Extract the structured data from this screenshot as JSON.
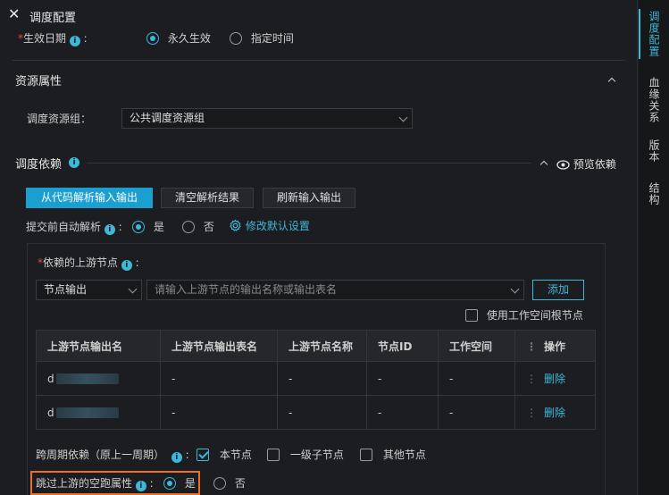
{
  "header": {
    "title": "调度配置"
  },
  "effective_date": {
    "label": "生效日期",
    "options": [
      "永久生效",
      "指定时间"
    ],
    "selected": "永久生效"
  },
  "resource_section": {
    "title": "资源属性",
    "group_label": "调度资源组：",
    "group_value": "公共调度资源组"
  },
  "dependency_section": {
    "title": "调度依赖",
    "preview_label": "预览依赖",
    "buttons": {
      "parse": "从代码解析输入输出",
      "clear": "清空解析结果",
      "refresh": "刷新输入输出"
    },
    "auto_parse": {
      "label": "提交前自动解析",
      "options": [
        "是",
        "否"
      ],
      "selected": "是",
      "modify_default": "修改默认设置"
    }
  },
  "upstream": {
    "label": "依赖的上游节点",
    "type_select": "节点输出",
    "input_placeholder": "请输入上游节点的输出名称或输出表名",
    "add_button": "添加",
    "use_root": "使用工作空间根节点",
    "columns": [
      "上游节点输出名",
      "上游节点输出表名",
      "上游节点名称",
      "节点ID",
      "工作空间",
      "操作"
    ],
    "rows": [
      {
        "output_prefix": "d",
        "output_table": "-",
        "node_name": "-",
        "node_id": "-",
        "workspace": "-",
        "action": "删除"
      },
      {
        "output_prefix": "d",
        "output_table": "-",
        "node_name": "-",
        "node_id": "-",
        "workspace": "-",
        "action": "删除"
      }
    ]
  },
  "cross_cycle": {
    "label": "跨周期依赖（原上一周期）",
    "options": [
      {
        "label": "本节点",
        "checked": true
      },
      {
        "label": "一级子节点",
        "checked": false
      },
      {
        "label": "其他节点",
        "checked": false
      }
    ]
  },
  "skip_dry_run": {
    "label": "跳过上游的空跑属性",
    "options": [
      "是",
      "否"
    ],
    "selected": "是"
  },
  "sidebar": {
    "items": [
      {
        "label": "调度配置",
        "active": true
      },
      {
        "label": "血缘关系",
        "active": false
      },
      {
        "label": "版本",
        "active": false
      },
      {
        "label": "结构",
        "active": false
      }
    ]
  },
  "colors": {
    "accent": "#3fb8d8",
    "primary_button": "#1b9fd1",
    "highlight_border": "#e8702a",
    "required": "#e5483f"
  },
  "icons": [
    "close-icon",
    "info-icon",
    "chevron-up-icon",
    "eye-icon",
    "gear-icon",
    "chevron-down-icon",
    "checkbox-icon",
    "radio-icon"
  ]
}
